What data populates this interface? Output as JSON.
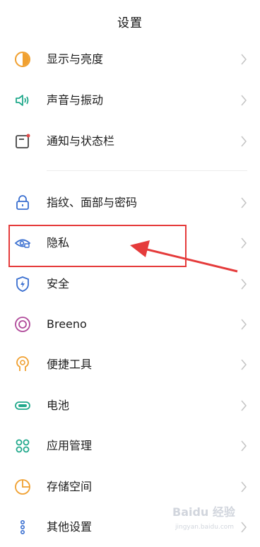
{
  "header": {
    "title": "设置"
  },
  "accent_color": "#22a98c",
  "highlight_color": "#e53b3b",
  "items": [
    {
      "label": "显示与亮度",
      "icon": "brightness-icon"
    },
    {
      "label": "声音与振动",
      "icon": "speaker-icon"
    },
    {
      "label": "通知与状态栏",
      "icon": "notification-icon"
    },
    {
      "label": "指纹、面部与密码",
      "icon": "lock-icon"
    },
    {
      "label": "隐私",
      "icon": "privacy-eye-icon"
    },
    {
      "label": "安全",
      "icon": "shield-icon"
    },
    {
      "label": "Breeno",
      "icon": "breeno-icon"
    },
    {
      "label": "便捷工具",
      "icon": "tools-icon"
    },
    {
      "label": "电池",
      "icon": "battery-icon"
    },
    {
      "label": "应用管理",
      "icon": "apps-grid-icon"
    },
    {
      "label": "存储空间",
      "icon": "storage-pie-icon"
    },
    {
      "label": "其他设置",
      "icon": "more-dots-icon"
    }
  ],
  "watermark": {
    "text": "Baidu 经验",
    "subtext": "jingyan.baidu.com"
  }
}
